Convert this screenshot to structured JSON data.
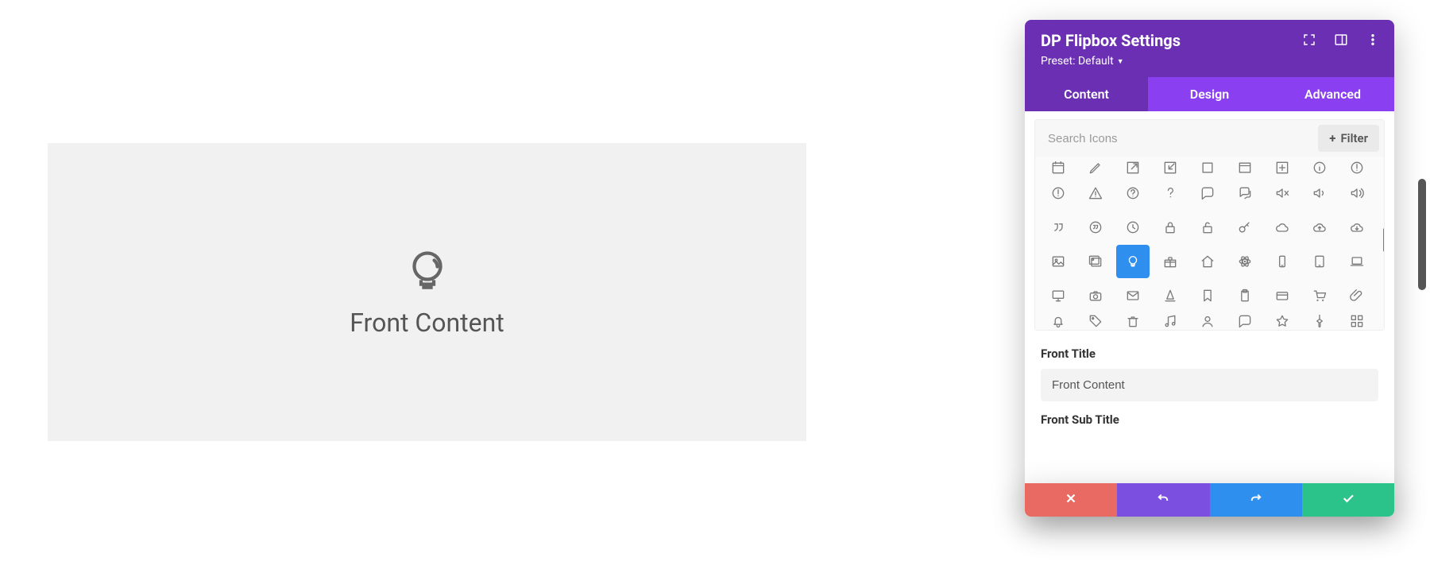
{
  "canvas": {
    "title": "Front Content",
    "icon": "lightbulb"
  },
  "panel": {
    "title": "DP Flipbox Settings",
    "preset_label": "Preset: Default",
    "tabs": [
      "Content",
      "Design",
      "Advanced"
    ],
    "active_tab": 0,
    "search_placeholder": "Search Icons",
    "filter_label": "Filter",
    "selected_icon": "lightbulb",
    "front_title_label": "Front Title",
    "front_title_value": "Front Content",
    "front_sub_title_label": "Front Sub Title",
    "icon_grid": {
      "partial_top_row": [
        "calendar",
        "pencil",
        "arrow-box-out",
        "arrow-box-in",
        "square",
        "window",
        "plus-square",
        "info-circle",
        "exclamation-circle"
      ],
      "rows": [
        [
          "exclamation-circle-o",
          "warning-triangle",
          "question-circle",
          "question",
          "comment",
          "comments",
          "volume-mute",
          "volume-low",
          "volume-high"
        ],
        [
          "quote-right",
          "quote-circle",
          "clock",
          "lock",
          "unlock",
          "key",
          "cloud",
          "cloud-up",
          "cloud-down"
        ],
        [
          "image",
          "images",
          "lightbulb",
          "gift",
          "home",
          "atom",
          "mobile",
          "tablet",
          "laptop"
        ],
        [
          "desktop",
          "camera",
          "envelope",
          "cone",
          "bookmark",
          "clipboard",
          "card",
          "cart",
          "paperclip"
        ]
      ],
      "partial_bottom_row": [
        "bell",
        "tag",
        "trash",
        "music",
        "user",
        "comment-o",
        "star",
        "pushpin",
        "grid"
      ]
    },
    "footer_actions": [
      "close",
      "undo",
      "redo",
      "save"
    ]
  }
}
